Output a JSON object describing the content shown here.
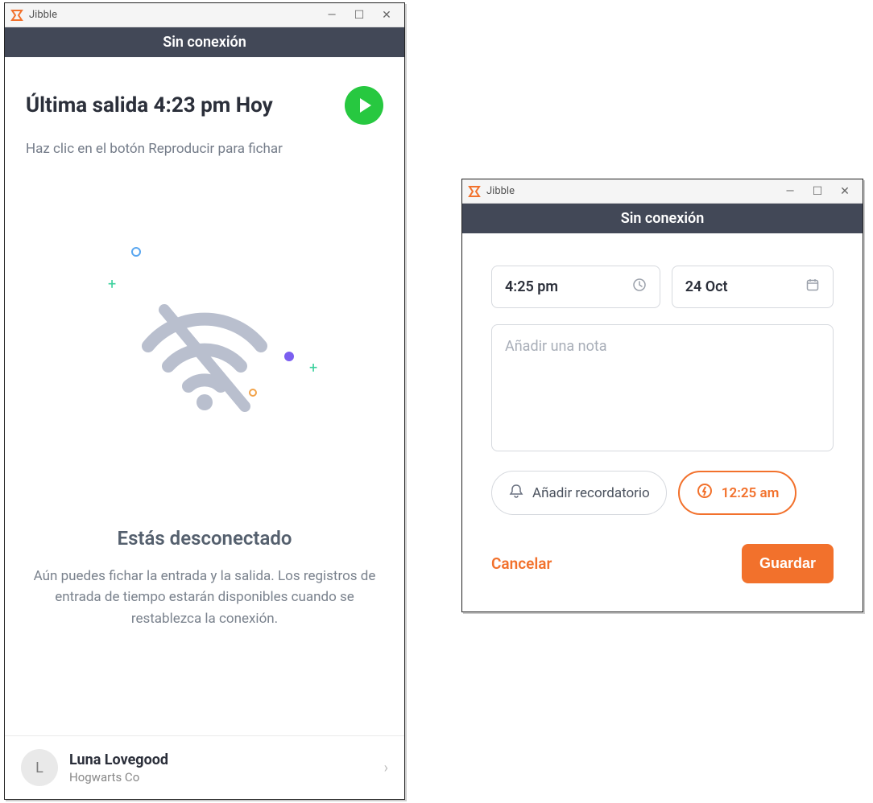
{
  "win1": {
    "title": "Jibble",
    "banner": "Sin conexión",
    "heading": "Última salida 4:23 pm Hoy",
    "hint": "Haz clic en el botón Reproducir para fichar",
    "disconnected_title": "Estás desconectado",
    "disconnected_body": "Aún puedes fichar la entrada y la salida. Los registros de entrada de tiempo estarán disponibles cuando se restablezca la conexión.",
    "profile": {
      "initial": "L",
      "name": "Luna Lovegood",
      "org": "Hogwarts Co"
    }
  },
  "win2": {
    "title": "Jibble",
    "banner": "Sin conexión",
    "time": "4:25 pm",
    "date": "24 Oct",
    "note_placeholder": "Añadir una nota",
    "reminder_label": "Añadir recordatorio",
    "reminder_time": "12:25 am",
    "cancel": "Cancelar",
    "save": "Guardar"
  },
  "colors": {
    "accent": "#f2712c",
    "play": "#27c840",
    "darkbar": "#424857"
  }
}
